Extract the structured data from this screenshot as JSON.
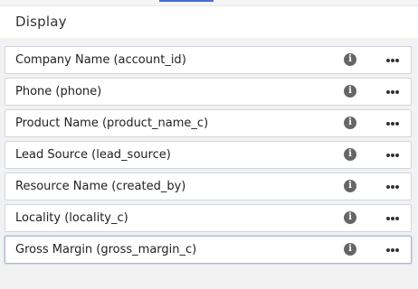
{
  "section": {
    "title": "Display"
  },
  "fields": [
    {
      "label": "Company Name (account_id)"
    },
    {
      "label": "Phone (phone)"
    },
    {
      "label": "Product Name (product_name_c)"
    },
    {
      "label": "Lead Source (lead_source)"
    },
    {
      "label": "Resource Name (created_by)"
    },
    {
      "label": "Locality (locality_c)"
    },
    {
      "label": "Gross Margin (gross_margin_c)"
    }
  ],
  "icons": {
    "info": "info-icon",
    "more": "more-options-icon"
  },
  "colors": {
    "active_tab_accent": "#4a6bd6",
    "row_border": "#cfd5de",
    "info_icon": "#666666"
  }
}
